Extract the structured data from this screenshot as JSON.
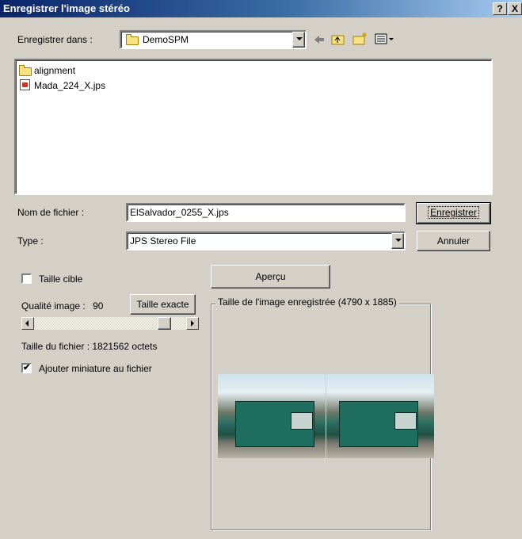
{
  "window": {
    "title": "Enregistrer l'image stéréo",
    "help_label": "?",
    "close_label": "X"
  },
  "toolbar": {
    "save_in_label": "Enregistrer dans :",
    "save_in_value": "DemoSPM",
    "icons": [
      "back-icon",
      "up-folder-icon",
      "new-folder-icon",
      "view-menu-icon"
    ]
  },
  "file_list": {
    "items": [
      {
        "name": "alignment",
        "type": "folder"
      },
      {
        "name": "Mada_224_X.jps",
        "type": "file"
      }
    ]
  },
  "form": {
    "filename_label": "Nom de fichier :",
    "filename_value": "ElSalvador_0255_X.jps",
    "type_label": "Type :",
    "type_value": "JPS Stereo File",
    "save_button": "Enregistrer",
    "cancel_button": "Annuler"
  },
  "options": {
    "target_size_label": "Taille cible",
    "target_size_checked": false,
    "preview_button": "Aperçu",
    "quality_label": "Qualité image :",
    "quality_value": "90",
    "exact_size_button": "Taille exacte",
    "quality_slider_fraction": 0.9,
    "file_size_text": "Taille du fichier : 1821562 octets",
    "thumbnail_label": "Ajouter miniature au fichier",
    "thumbnail_checked": true,
    "check_mark": "✔"
  },
  "preview": {
    "group_label": "Taille de l'image enregistrée (4790 x 1885)"
  }
}
